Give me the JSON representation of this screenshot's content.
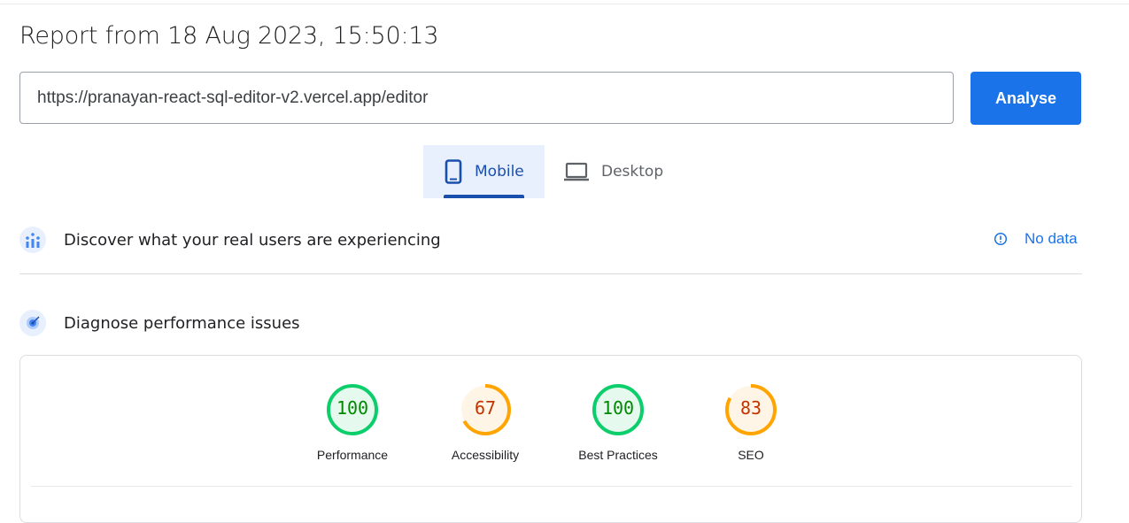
{
  "report": {
    "title": "Report from 18 Aug 2023, 15:50:13"
  },
  "search": {
    "url_value": "https://pranayan-react-sql-editor-v2.vercel.app/editor",
    "analyse_label": "Analyse"
  },
  "tabs": [
    {
      "label": "Mobile",
      "icon": "smartphone-icon",
      "selected": true
    },
    {
      "label": "Desktop",
      "icon": "laptop-icon",
      "selected": false
    }
  ],
  "sections": {
    "real_users": {
      "title": "Discover what your real users are experiencing",
      "icon": "crux-chart-icon",
      "no_data_label": "No data",
      "no_data_icon": "info-icon"
    },
    "diagnose": {
      "title": "Diagnose performance issues",
      "icon": "lighthouse-icon"
    }
  },
  "scores": [
    {
      "label": "Performance",
      "value": 100,
      "color": "#0cce6b",
      "text_color": "#008800",
      "bg": "#e6f9ee"
    },
    {
      "label": "Accessibility",
      "value": 67,
      "color": "#ffa400",
      "text_color": "#c33300",
      "bg": "#fff5e6"
    },
    {
      "label": "Best Practices",
      "value": 100,
      "color": "#0cce6b",
      "text_color": "#008800",
      "bg": "#e6f9ee"
    },
    {
      "label": "SEO",
      "value": 83,
      "color": "#ffa400",
      "text_color": "#c33300",
      "bg": "#fff5e6"
    }
  ],
  "colors": {
    "accent": "#1a73e8",
    "tab_selected": "#1a4fae"
  }
}
